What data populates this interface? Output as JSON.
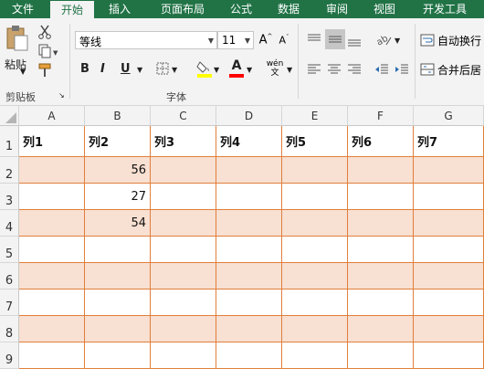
{
  "tabs": [
    "文件",
    "开始",
    "插入",
    "页面布局",
    "公式",
    "数据",
    "审阅",
    "视图",
    "开发工具"
  ],
  "active_tab": "开始",
  "clipboard": {
    "paste_label": "粘贴",
    "group_label": "剪贴板"
  },
  "font": {
    "name": "等线",
    "size": "11",
    "group_label": "字体",
    "bold": "B",
    "italic": "I",
    "underline": "U",
    "fill_letter": "A",
    "font_color_letter": "A",
    "phonetic": "wén\n文"
  },
  "alignment": {
    "wrap_text": "自动换行",
    "merge_center": "合并后居"
  },
  "colors": {
    "accent": "#217346",
    "band": "#f8e0d2",
    "border": "#e07f3c",
    "fill_yellow": "#ffff00",
    "font_red": "#ff0000"
  },
  "columns": [
    "A",
    "B",
    "C",
    "D",
    "E",
    "F",
    "G"
  ],
  "rows": [
    "1",
    "2",
    "3",
    "4",
    "5",
    "6",
    "7",
    "8",
    "9"
  ],
  "sheet": {
    "header_row": [
      "列1",
      "列2",
      "列3",
      "列4",
      "列5",
      "列6",
      "列7"
    ],
    "data": [
      [
        "",
        "56",
        "",
        "",
        "",
        "",
        ""
      ],
      [
        "",
        "27",
        "",
        "",
        "",
        "",
        ""
      ],
      [
        "",
        "54",
        "",
        "",
        "",
        "",
        ""
      ],
      [
        "",
        "",
        "",
        "",
        "",
        "",
        ""
      ],
      [
        "",
        "",
        "",
        "",
        "",
        "",
        ""
      ],
      [
        "",
        "",
        "",
        "",
        "",
        "",
        ""
      ],
      [
        "",
        "",
        "",
        "",
        "",
        "",
        ""
      ],
      [
        "",
        "",
        "",
        "",
        "",
        "",
        ""
      ]
    ]
  }
}
